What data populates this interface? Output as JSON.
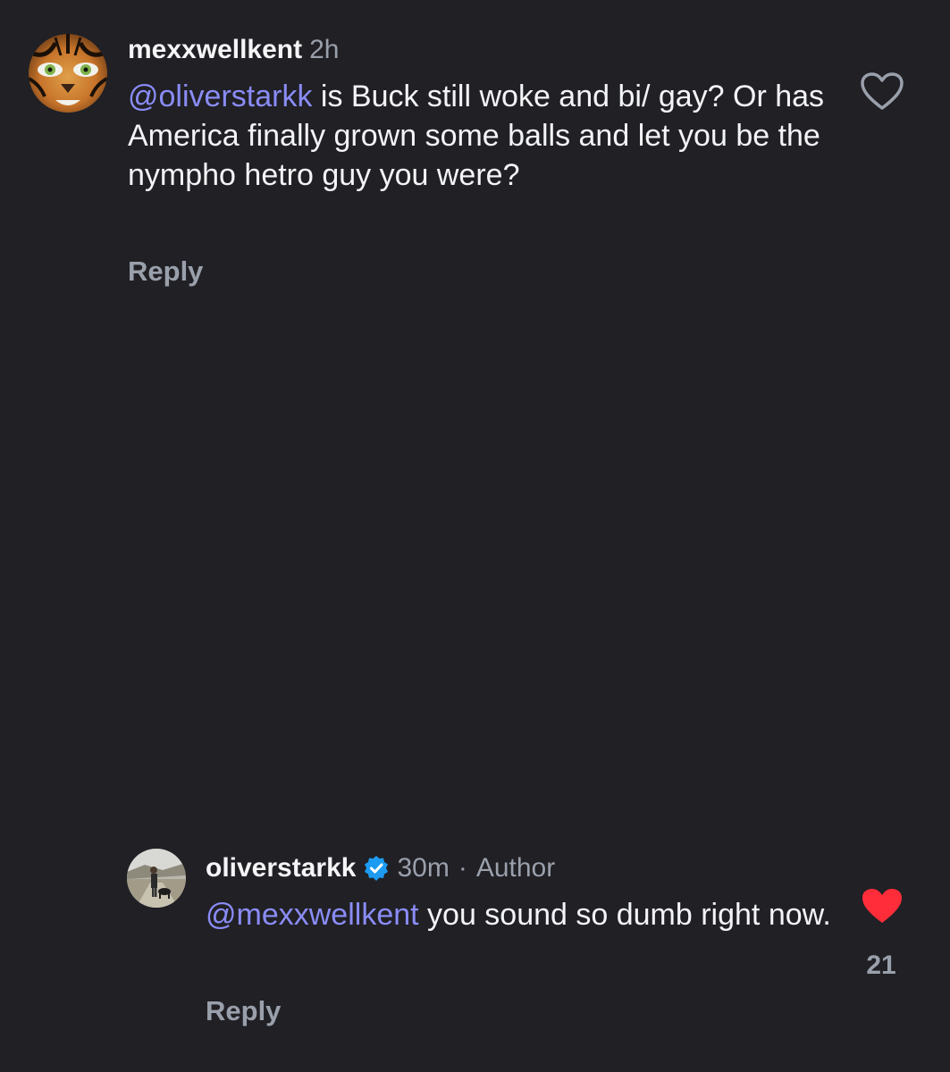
{
  "comment": {
    "username": "mexxwellkent",
    "time": "2h",
    "mention": "@oliverstarkk",
    "text": " is Buck still woke and bi/ gay? Or has America finally grown some balls and let you be the nympho hetro guy you were?",
    "reply_label": "Reply",
    "like_icon": "heart-outline-icon"
  },
  "reply": {
    "username": "oliverstarkk",
    "verified_icon": "verified-badge-icon",
    "time": "30m",
    "separator": "·",
    "author_label": "Author",
    "mention": "@mexxwellkent",
    "text": " you sound so dumb right now.",
    "reply_label": "Reply",
    "like_icon": "heart-filled-icon",
    "like_count": "21",
    "like_color": "#ff2d3a"
  },
  "colors": {
    "background": "#202025",
    "mention": "#8a8cf6",
    "secondary_text": "#9aa0ab",
    "verified": "#1d9bf0"
  }
}
